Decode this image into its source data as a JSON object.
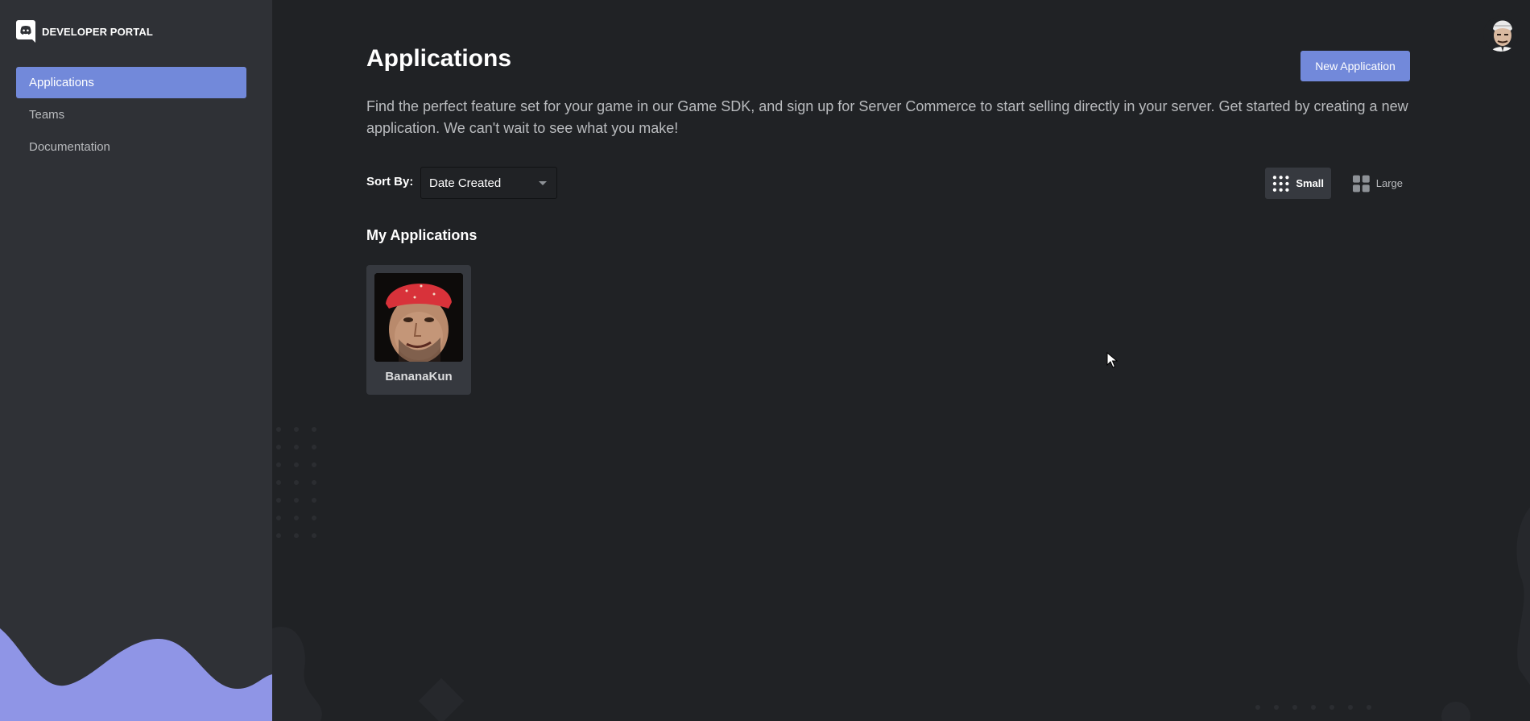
{
  "sidebar": {
    "brand": "DEVELOPER PORTAL",
    "items": [
      {
        "label": "Applications",
        "active": true
      },
      {
        "label": "Teams",
        "active": false
      },
      {
        "label": "Documentation",
        "active": false
      }
    ]
  },
  "header": {
    "title": "Applications",
    "new_app_label": "New Application",
    "intro": "Find the perfect feature set for your game in our Game SDK, and sign up for Server Commerce to start selling directly in your server. Get started by creating a new application. We can't wait to see what you make!"
  },
  "toolbar": {
    "sort_label": "Sort By:",
    "sort_value": "Date Created",
    "view_small_label": "Small",
    "view_large_label": "Large"
  },
  "my_apps": {
    "title": "My Applications",
    "apps": [
      {
        "name": "BananaKun"
      }
    ]
  },
  "colors": {
    "accent": "#7289da",
    "background": "#202225",
    "sidebar": "#2f3136",
    "card": "#36393f"
  },
  "icons": {
    "brand": "discord-logo-icon",
    "view_small": "grid-small-icon",
    "view_large": "grid-large-icon",
    "sort_caret": "chevron-down-icon"
  }
}
